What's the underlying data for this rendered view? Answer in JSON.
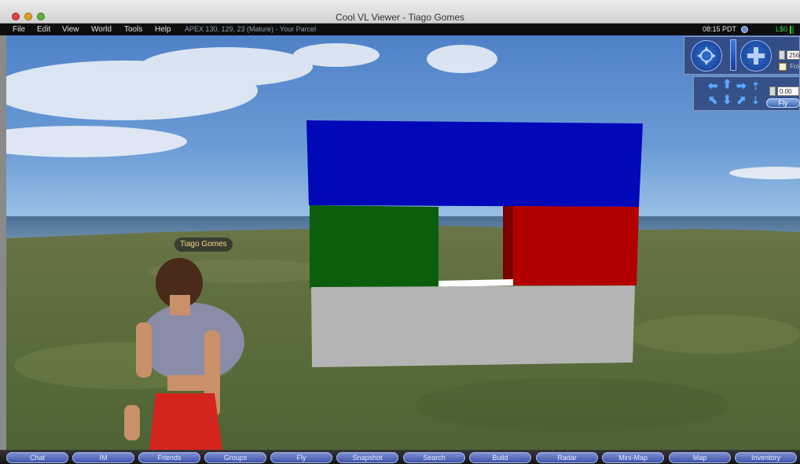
{
  "window": {
    "title": "Cool VL Viewer - Tiago Gomes"
  },
  "menu": {
    "items": [
      {
        "label": "File"
      },
      {
        "label": "Edit"
      },
      {
        "label": "View"
      },
      {
        "label": "World"
      },
      {
        "label": "Tools"
      },
      {
        "label": "Help"
      }
    ],
    "parcel_info": "APEX 130, 129, 23 (Mature) - Your Parcel"
  },
  "status": {
    "time": "08:15 PDT",
    "balance": "L$0"
  },
  "scene": {
    "avatar_name": "Tiago Gomes"
  },
  "camera_controls": {
    "zoom_value": "256",
    "checkbox_label": "Fro"
  },
  "movement_controls": {
    "value": "0.00",
    "fly_label": "Fly"
  },
  "toolbar": {
    "buttons": [
      {
        "label": "Chat"
      },
      {
        "label": "IM"
      },
      {
        "label": "Friends"
      },
      {
        "label": "Groups"
      },
      {
        "label": "Fly"
      },
      {
        "label": "Snapshot"
      },
      {
        "label": "Search"
      },
      {
        "label": "Build"
      },
      {
        "label": "Radar"
      },
      {
        "label": "Mini-Map"
      },
      {
        "label": "Map"
      },
      {
        "label": "Inventory"
      }
    ]
  },
  "icons": {
    "close": "close-dot-icon",
    "minimize": "minimize-dot-icon",
    "maximize": "maximize-dot-icon",
    "clock": "sun-moon-icon",
    "signal": "signal-bars-icon",
    "orbit": "camera-orbit-icon",
    "pan": "camera-pan-icon"
  },
  "colors": {
    "accent": "#4a5fb8",
    "balance": "#3bd23b",
    "block_blue": "#0008b8",
    "block_green": "#0b5e0b",
    "block_red": "#b20000",
    "block_gray": "#b4b4b4"
  }
}
